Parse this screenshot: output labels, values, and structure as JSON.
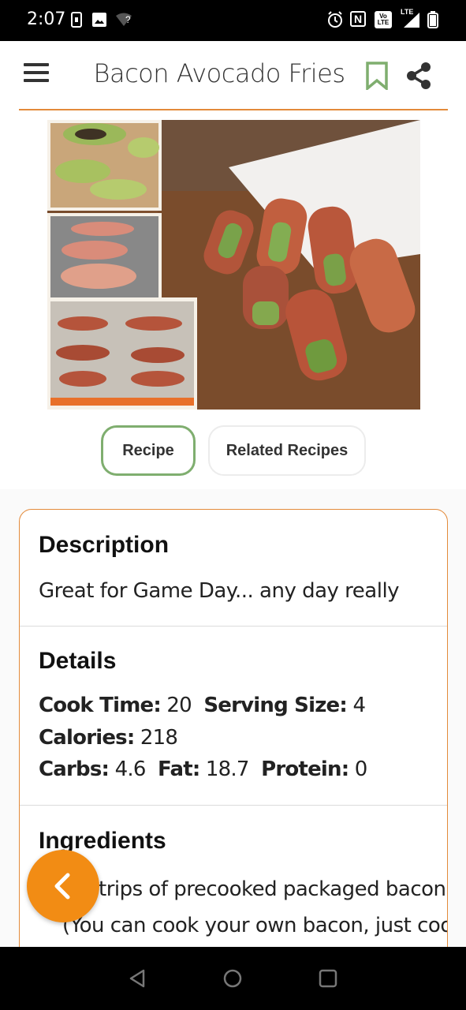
{
  "status_bar": {
    "time": "2:07",
    "icons": [
      "sim-card-icon",
      "image-icon",
      "wifi-question-icon",
      "alarm-icon",
      "nfc-icon",
      "volte-icon",
      "lte-signal-icon",
      "battery-icon"
    ],
    "wifi_label": "?",
    "nfc_label": "N",
    "volte_label": "Vo LTE",
    "lte_label": "LTE"
  },
  "app_bar": {
    "title": "Bacon Avocado Fries",
    "menu_icon": "hamburger-menu-icon",
    "bookmark_icon": "bookmark-icon",
    "share_icon": "share-icon"
  },
  "colors": {
    "accent_orange": "#e38a3a",
    "fab_orange": "#f28c14",
    "tab_green": "#7fae6f"
  },
  "tabs": [
    {
      "label": "Recipe",
      "active": true
    },
    {
      "label": "Related Recipes",
      "active": false
    }
  ],
  "description": {
    "title": "Description",
    "text": "Great for Game Day... any day really"
  },
  "details": {
    "title": "Details",
    "cook_time_label": "Cook Time:",
    "cook_time": "20",
    "serving_size_label": "Serving Size:",
    "serving_size": "4",
    "calories_label": "Calories:",
    "calories": "218",
    "carbs_label": "Carbs:",
    "carbs": "4.6",
    "fat_label": "Fat:",
    "fat": "18.7",
    "protein_label": "Protein:",
    "protein": "0"
  },
  "ingredients": {
    "title": "Ingredients",
    "lines": [
      "trips of precooked packaged bacon",
      "(You can cook your own bacon, just cook it"
    ]
  },
  "fab": {
    "icon": "chevron-left-icon"
  },
  "nav_bar": {
    "icons": [
      "back-triangle-icon",
      "home-circle-icon",
      "recents-square-icon"
    ]
  }
}
